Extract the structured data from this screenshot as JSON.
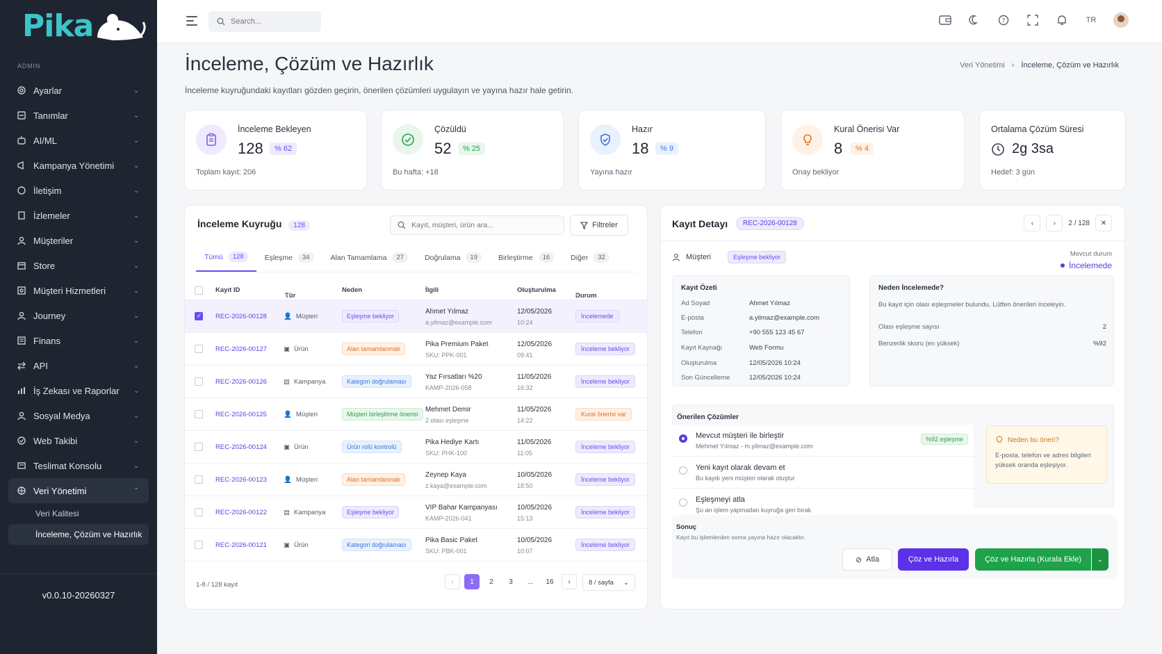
{
  "app": {
    "logo_text": "Pika",
    "version": "v0.0.10-20260327"
  },
  "sidebar": {
    "section_label": "ADMIN",
    "items": [
      {
        "label": "Ayarlar",
        "icon": "gear-icon"
      },
      {
        "label": "Tanımlar",
        "icon": "list-icon"
      },
      {
        "label": "AI/ML",
        "icon": "robot-icon"
      },
      {
        "label": "Kampanya Yönetimi",
        "icon": "megaphone-icon"
      },
      {
        "label": "İletişim",
        "icon": "chat-icon"
      },
      {
        "label": "İzlemeler",
        "icon": "report-icon"
      },
      {
        "label": "Müşteriler",
        "icon": "user-icon"
      },
      {
        "label": "Store",
        "icon": "store-icon"
      },
      {
        "label": "Müşteri Hizmetleri",
        "icon": "support-icon"
      },
      {
        "label": "Journey",
        "icon": "journey-icon"
      },
      {
        "label": "Finans",
        "icon": "finance-icon"
      },
      {
        "label": "API",
        "icon": "api-icon"
      },
      {
        "label": "İş Zekası ve Raporlar",
        "icon": "chart-icon"
      },
      {
        "label": "Sosyal Medya",
        "icon": "social-icon"
      },
      {
        "label": "Web Takibi",
        "icon": "web-icon"
      },
      {
        "label": "Teslimat Konsolu",
        "icon": "delivery-icon"
      },
      {
        "label": "Veri Yönetimi",
        "icon": "database-icon"
      }
    ],
    "sub_items": [
      "Veri Kalitesi",
      "İnceleme, Çözüm ve Hazırlık"
    ]
  },
  "topbar": {
    "search_placeholder": "Search...",
    "lang": "TR"
  },
  "page": {
    "title": "İnceleme, Çözüm ve Hazırlık",
    "subtitle": "İnceleme kuyruğundaki kayıtları gözden geçirin, önerilen çözümleri uygulayın ve yayına hazır hale getirin.",
    "breadcrumb": [
      "Veri Yönetimi",
      "İnceleme, Çözüm ve Hazırlık"
    ]
  },
  "stats": [
    {
      "title": "İnceleme Bekleyen",
      "value": "128",
      "badge": "% 62",
      "note": "Toplam kayıt: 206",
      "color": "#7c5cf0"
    },
    {
      "title": "Çözüldü",
      "value": "52",
      "badge": "% 25",
      "note": "Bu hafta: +18",
      "color": "#22a34a"
    },
    {
      "title": "Hazır",
      "value": "18",
      "badge": "% 9",
      "note": "Yayına hazır",
      "color": "#3d73e0"
    },
    {
      "title": "Kural Önerisi Var",
      "value": "8",
      "badge": "% 4",
      "note": "Onay bekliyor",
      "color": "#e07020"
    },
    {
      "title": "Ortalama Çözüm Süresi",
      "value": "2g 3sa",
      "note": "Hedef: 3 gün"
    }
  ],
  "queue": {
    "title": "İnceleme Kuyruğu",
    "count": "128",
    "search_placeholder": "Kayıt, müşteri, ürün ara...",
    "filter_label": "Filtreler",
    "tabs": [
      {
        "label": "Tümü",
        "count": "128"
      },
      {
        "label": "Eşleşme",
        "count": "34"
      },
      {
        "label": "Alan Tamamlama",
        "count": "27"
      },
      {
        "label": "Doğrulama",
        "count": "19"
      },
      {
        "label": "Birleştirme",
        "count": "16"
      },
      {
        "label": "Diğer",
        "count": "32"
      }
    ],
    "columns": [
      "Kayıt ID",
      "Tür",
      "Neden",
      "İlgili",
      "Oluşturulma",
      "Durum"
    ],
    "rows": [
      {
        "id": "REC-2026-00128",
        "type": "Müşteri",
        "reason": "Eşleşme bekliyor",
        "rel1": "Ahmet Yılmaz",
        "rel2": "a.yilmaz@example.com",
        "date": "12/05/2026",
        "time": "10:24",
        "status": "İncelemede"
      },
      {
        "id": "REC-2026-00127",
        "type": "Ürün",
        "reason": "Alan tamamlanmalı",
        "rel1": "Pika Premium Paket",
        "rel2": "SKU: PPK-001",
        "date": "12/05/2026",
        "time": "09:41",
        "status": "İnceleme bekliyor"
      },
      {
        "id": "REC-2026-00126",
        "type": "Kampanya",
        "reason": "Kategori doğrulaması",
        "rel1": "Yaz Fırsatları %20",
        "rel2": "KAMP-2026-058",
        "date": "11/05/2026",
        "time": "16:32",
        "status": "İnceleme bekliyor"
      },
      {
        "id": "REC-2026-00125",
        "type": "Müşteri",
        "reason": "Müşteri birleştirme önerisi",
        "rel1": "Mehmet Demir",
        "rel2": "2 olası eşleşme",
        "date": "11/05/2026",
        "time": "14:22",
        "status": "Kural önerisi var"
      },
      {
        "id": "REC-2026-00124",
        "type": "Ürün",
        "reason": "Ürün rolü kontrolü",
        "rel1": "Pika Hediye Kartı",
        "rel2": "SKU: PHK-100",
        "date": "11/05/2026",
        "time": "11:05",
        "status": "İnceleme bekliyor"
      },
      {
        "id": "REC-2026-00123",
        "type": "Müşteri",
        "reason": "Alan tamamlanmalı",
        "rel1": "Zeynep Kaya",
        "rel2": "z.kaya@example.com",
        "date": "10/05/2026",
        "time": "18:50",
        "status": "İnceleme bekliyor"
      },
      {
        "id": "REC-2026-00122",
        "type": "Kampanya",
        "reason": "Eşleşme bekliyor",
        "rel1": "VIP Bahar Kampanyası",
        "rel2": "KAMP-2026-041",
        "date": "10/05/2026",
        "time": "15:13",
        "status": "İnceleme bekliyor"
      },
      {
        "id": "REC-2026-00121",
        "type": "Ürün",
        "reason": "Kategori doğrulaması",
        "rel1": "Pika Basic Paket",
        "rel2": "SKU: PBK-001",
        "date": "10/05/2026",
        "time": "10:07",
        "status": "İnceleme bekliyor"
      }
    ],
    "footer": "1-8 / 128 kayıt",
    "pages": [
      "1",
      "2",
      "3",
      "...",
      "16"
    ],
    "per_page": "8 / sayfa"
  },
  "detail": {
    "title": "Kayıt Detayı",
    "id": "REC-2026-00128",
    "position": "2 / 128",
    "entity": "Müşteri",
    "entity_tag": "Eşleşme bekliyor",
    "current_label": "Mevcut durum",
    "current_value": "İncelemede",
    "summary": {
      "title": "Kayıt Özeti",
      "rows": [
        {
          "k": "Ad Soyad",
          "v": "Ahmet Yılmaz"
        },
        {
          "k": "E-posta",
          "v": "a.yilmaz@example.com"
        },
        {
          "k": "Telefon",
          "v": "+90 555 123 45 67"
        },
        {
          "k": "Kayıt Kaynağı",
          "v": "Web Formu"
        },
        {
          "k": "Oluşturulma",
          "v": "12/05/2026 10:24"
        },
        {
          "k": "Son Güncelleme",
          "v": "12/05/2026 10:24"
        }
      ]
    },
    "why_review": {
      "title": "Neden İncelemede?",
      "desc": "Bu kayıt için olası eşleşmeler bulundu. Lütfen önerileri inceleyin.",
      "rows": [
        {
          "k": "Olası eşleşme sayısı",
          "v": "2"
        },
        {
          "k": "Benzerlik skoru (en yüksek)",
          "v": "%92"
        }
      ]
    },
    "solutions": {
      "title": "Önerilen Çözümler",
      "items": [
        {
          "t1": "Mevcut müşteri ile birleştir",
          "t2": "Mehmet Yılmaz - m.yilmaz@example.com",
          "match": "%92 eşleşme"
        },
        {
          "t1": "Yeni kayıt olarak devam et",
          "t2": "Bu kaydı yeni müşteri olarak oluştur"
        },
        {
          "t1": "Eşleşmeyi atla",
          "t2": "Şu an işlem yapmadan kuyruğa geri bırak"
        }
      ]
    },
    "why_suggest": {
      "title": "Neden bu öneri?",
      "desc": "E-posta, telefon ve adres bilgileri yüksek oranda eşleşiyor."
    },
    "result": {
      "title": "Sonuç",
      "desc": "Kayıt bu işlemlerden sonra yayına hazır olacaktır.",
      "skip": "Atla",
      "solve": "Çöz ve Hazırla",
      "solve_rule": "Çöz ve Hazırla (Kurala Ekle)"
    }
  }
}
